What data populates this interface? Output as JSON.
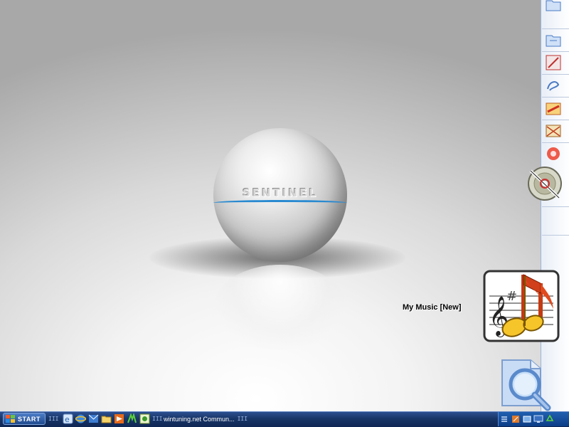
{
  "desktop": {
    "sphere_label": "SENTINEL",
    "icons": {
      "my_music": {
        "label": "My Music [New]",
        "icon": "music-note-icon"
      }
    }
  },
  "right_bar": {
    "icons": [
      "folder-icon",
      "folder-icon",
      "pencil-icon",
      "pen-icon",
      "paint-icon",
      "picture-icon",
      "lifebuoy-icon",
      "cd-icon"
    ]
  },
  "search_icon": "magnifier-icon",
  "taskbar": {
    "start_label": "START",
    "grip": "III",
    "quick_launch": [
      "internet-explorer-icon",
      "ie-icon",
      "outlook-icon",
      "folder-icon",
      "media-icon",
      "winamp-icon",
      "app-icon"
    ],
    "task_item": {
      "label": "wintuning.net Commun...",
      "icon": "ie-icon"
    },
    "task_grip": "III",
    "tray_icons": [
      "menu-icon",
      "network-icon",
      "tray-icon",
      "display-icon",
      "recycle-icon"
    ]
  },
  "colors": {
    "taskbar": "#183567",
    "accent_band": "#2a8ad0",
    "tray": "#0d3d86"
  }
}
